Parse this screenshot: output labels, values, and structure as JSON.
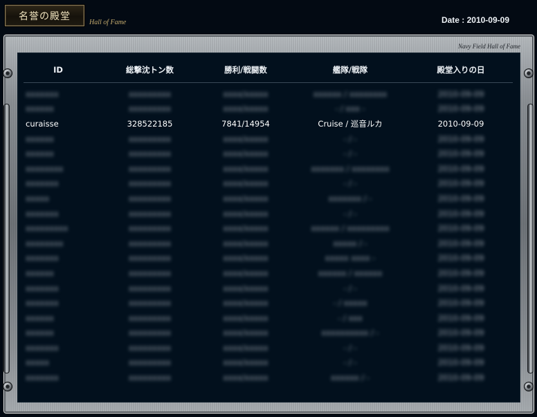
{
  "header": {
    "title_plate": "名誉の殿堂",
    "subtitle": "Hall of Fame",
    "date_label": "Date : 2010-09-09"
  },
  "frame": {
    "caption": "Navy Field Hall of Fame"
  },
  "table": {
    "columns": [
      "ID",
      "総撃沈トン数",
      "勝利/戦闘数",
      "艦隊/戦隊",
      "殿堂入りの日"
    ],
    "rows": [
      {
        "id": "xxxxxxx",
        "tons": "xxxxxxxxx",
        "wins": "xxxx/xxxxx",
        "fleet": "xxxxxx / xxxxxxxx",
        "date": "2010-09-09",
        "blurred": true
      },
      {
        "id": "xxxxxx",
        "tons": "xxxxxxxxx",
        "wins": "xxxx/xxxxx",
        "fleet": "- / xxx -",
        "date": "2010-09-09",
        "blurred": true
      },
      {
        "id": "curaisse",
        "tons": "328522185",
        "wins": "7841/14954",
        "fleet": "Cruise / 巡音ルカ",
        "date": "2010-09-09",
        "blurred": false
      },
      {
        "id": "xxxxxx",
        "tons": "xxxxxxxxx",
        "wins": "xxxx/xxxxx",
        "fleet": "- / -",
        "date": "2010-09-09",
        "blurred": true
      },
      {
        "id": "xxxxxx",
        "tons": "xxxxxxxxx",
        "wins": "xxxx/xxxxx",
        "fleet": "- / -",
        "date": "2010-09-09",
        "blurred": true
      },
      {
        "id": "xxxxxxxx",
        "tons": "xxxxxxxxx",
        "wins": "xxxx/xxxxx",
        "fleet": "xxxxxxx / xxxxxxxx",
        "date": "2010-09-09",
        "blurred": true
      },
      {
        "id": "xxxxxxx",
        "tons": "xxxxxxxxx",
        "wins": "xxxx/xxxxx",
        "fleet": "- / -",
        "date": "2010-09-09",
        "blurred": true
      },
      {
        "id": "xxxxx",
        "tons": "xxxxxxxxx",
        "wins": "xxxx/xxxxx",
        "fleet": "xxxxxxx / -",
        "date": "2010-09-09",
        "blurred": true
      },
      {
        "id": "xxxxxxx",
        "tons": "xxxxxxxxx",
        "wins": "xxxx/xxxxx",
        "fleet": "- / -",
        "date": "2010-09-09",
        "blurred": true
      },
      {
        "id": "xxxxxxxxx",
        "tons": "xxxxxxxxx",
        "wins": "xxxx/xxxxx",
        "fleet": "xxxxxx / xxxxxxxxx",
        "date": "2010-09-09",
        "blurred": true
      },
      {
        "id": "xxxxxxxx",
        "tons": "xxxxxxxxx",
        "wins": "xxxx/xxxxx",
        "fleet": "xxxxx / -",
        "date": "2010-09-09",
        "blurred": true
      },
      {
        "id": "xxxxxxx",
        "tons": "xxxxxxxxx",
        "wins": "xxxx/xxxxx",
        "fleet": "xxxxx xxxx -",
        "date": "2010-09-09",
        "blurred": true
      },
      {
        "id": "xxxxxx",
        "tons": "xxxxxxxxx",
        "wins": "xxxx/xxxxx",
        "fleet": "xxxxxx / xxxxxx",
        "date": "2010-09-09",
        "blurred": true
      },
      {
        "id": "xxxxxxx",
        "tons": "xxxxxxxxx",
        "wins": "xxxx/xxxxx",
        "fleet": "- / -",
        "date": "2010-09-09",
        "blurred": true
      },
      {
        "id": "xxxxxxx",
        "tons": "xxxxxxxxx",
        "wins": "xxxx/xxxxx",
        "fleet": "- / xxxxx",
        "date": "2010-09-09",
        "blurred": true
      },
      {
        "id": "xxxxxx",
        "tons": "xxxxxxxxx",
        "wins": "xxxx/xxxxx",
        "fleet": "- / xxx",
        "date": "2010-09-09",
        "blurred": true
      },
      {
        "id": "xxxxxx",
        "tons": "xxxxxxxxx",
        "wins": "xxxx/xxxxx",
        "fleet": "xxxxxxxxxx / -",
        "date": "2010-09-09",
        "blurred": true
      },
      {
        "id": "xxxxxxx",
        "tons": "xxxxxxxxx",
        "wins": "xxxx/xxxxx",
        "fleet": "- / -",
        "date": "2010-09-09",
        "blurred": true
      },
      {
        "id": "xxxxx",
        "tons": "xxxxxxxxx",
        "wins": "xxxx/xxxxx",
        "fleet": "- / -",
        "date": "2010-09-09",
        "blurred": true
      },
      {
        "id": "xxxxxxx",
        "tons": "xxxxxxxxx",
        "wins": "xxxx/xxxxx",
        "fleet": "xxxxxx / -",
        "date": "2010-09-09",
        "blurred": true
      }
    ]
  }
}
